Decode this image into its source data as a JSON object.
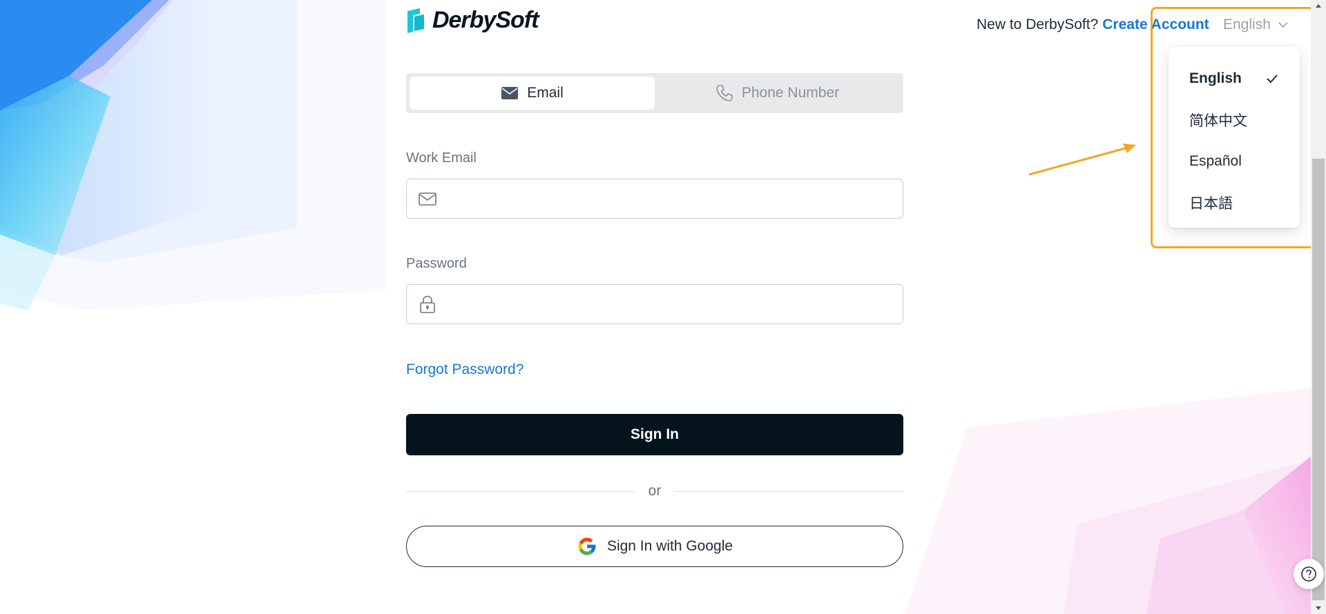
{
  "header": {
    "logo_text": "DerbySoft",
    "signup_prompt": "New to DerbySoft?",
    "create_account_label": "Create Account",
    "language_selected": "English"
  },
  "language_menu": {
    "items": [
      {
        "label": "English",
        "selected": true
      },
      {
        "label": "简体中文",
        "selected": false
      },
      {
        "label": "Español",
        "selected": false
      },
      {
        "label": "日本語",
        "selected": false
      }
    ]
  },
  "tabs": [
    {
      "label": "Email",
      "icon": "envelope-icon",
      "active": true
    },
    {
      "label": "Phone Number",
      "icon": "phone-icon",
      "active": false
    }
  ],
  "form": {
    "email_label": "Work Email",
    "email_value": "",
    "password_label": "Password",
    "password_value": "",
    "forgot_label": "Forgot Password?",
    "signin_label": "Sign In",
    "divider_text": "or",
    "google_label": "Sign In with Google"
  },
  "colors": {
    "accent": "#1677d6",
    "primary_button": "#05141c",
    "highlight": "#f5a623",
    "logo_mark": "#18c7d9"
  }
}
